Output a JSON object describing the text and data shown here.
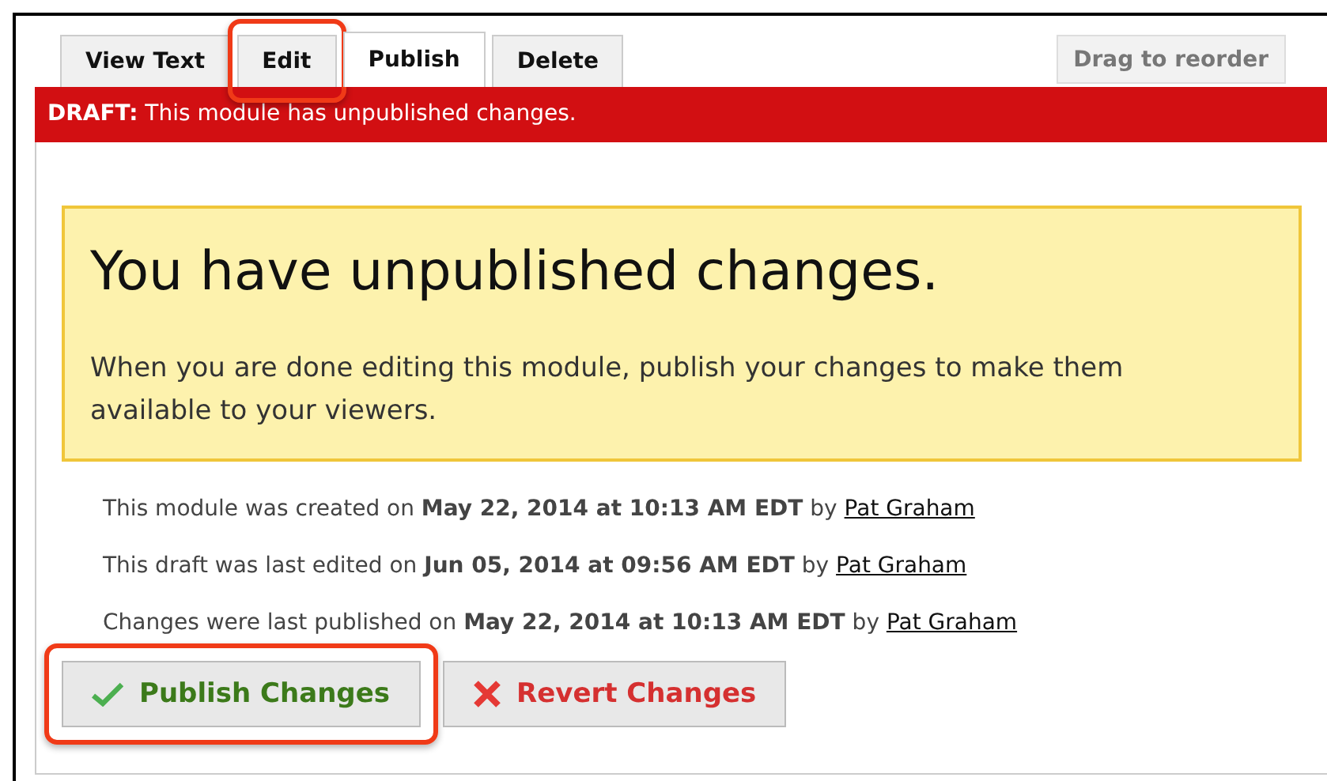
{
  "tabs": [
    {
      "label": "View Text",
      "selected": false,
      "highlighted": false
    },
    {
      "label": "Edit",
      "selected": false,
      "highlighted": true
    },
    {
      "label": "Publish",
      "selected": true,
      "highlighted": false
    },
    {
      "label": "Delete",
      "selected": false,
      "highlighted": false
    }
  ],
  "reorder_button": "Drag to reorder",
  "draft_banner": "**DRAFT:** This module has unpublished changes.",
  "notice": {
    "heading": "You have unpublished changes.",
    "message": "When you are done editing this module, publish your changes to make them available to your viewers."
  },
  "history": [
    {
      "text": "This module was created on **May 22, 2014 at 10:13 AM EDT** by",
      "author": "Pat Graham"
    },
    {
      "text": "This draft was last edited on **Jun 05, 2014 at 09:56 AM EDT** by",
      "author": "Pat Graham"
    },
    {
      "text": "Changes were last published on **May 22, 2014 at 10:13 AM EDT** by",
      "author": "Pat Graham"
    }
  ],
  "buttons": [
    {
      "kind": "publish",
      "label": "Publish Changes",
      "highlighted": true
    },
    {
      "kind": "revert",
      "label": "Revert Changes",
      "highlighted": false
    }
  ]
}
